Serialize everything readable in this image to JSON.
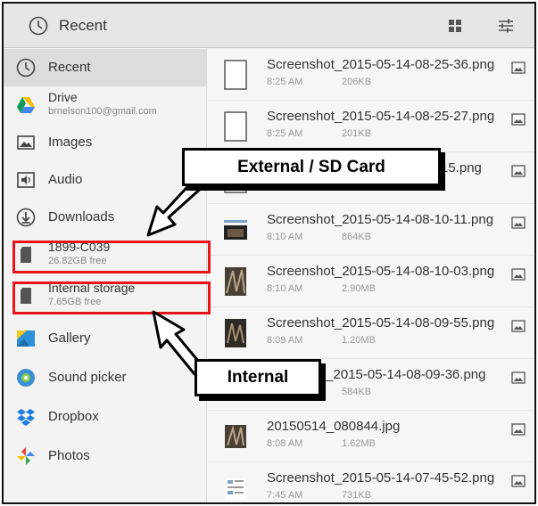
{
  "header": {
    "title": "Recent"
  },
  "sidebar": {
    "items": [
      {
        "label": "Recent",
        "icon": "clock-icon"
      },
      {
        "label": "Drive",
        "sublabel": "brnelson100@gmail.com",
        "icon": "drive-icon"
      },
      {
        "label": "Images",
        "icon": "image-icon"
      },
      {
        "label": "Audio",
        "icon": "audio-icon"
      },
      {
        "label": "Downloads",
        "icon": "download-icon"
      },
      {
        "label": "1899-C039",
        "sublabel": "26.82GB free",
        "icon": "sd-card-icon"
      },
      {
        "label": "Internal storage",
        "sublabel": "7.65GB free",
        "icon": "sd-card-icon"
      },
      {
        "label": "Gallery",
        "icon": "gallery-icon"
      },
      {
        "label": "Sound picker",
        "icon": "sound-picker-icon"
      },
      {
        "label": "Dropbox",
        "icon": "dropbox-icon"
      },
      {
        "label": "Photos",
        "icon": "photos-icon"
      }
    ]
  },
  "files": [
    {
      "name": "Screenshot_2015-05-14-08-25-36.png",
      "time": "8:25 AM",
      "size": "206KB",
      "thumb": "blank"
    },
    {
      "name": "Screenshot_2015-05-14-08-25-27.png",
      "time": "8:25 AM",
      "size": "201KB",
      "thumb": "blank"
    },
    {
      "name": "-15.png",
      "time": "",
      "size": "",
      "thumb": "blank"
    },
    {
      "name": "Screenshot_2015-05-14-08-10-11.png",
      "time": "8:10 AM",
      "size": "864KB",
      "thumb": "wide"
    },
    {
      "name": "Screenshot_2015-05-14-08-10-03.png",
      "time": "8:10 AM",
      "size": "2.90MB",
      "thumb": "photo"
    },
    {
      "name": "Screenshot_2015-05-14-08-09-55.png",
      "time": "8:09 AM",
      "size": "1.20MB",
      "thumb": "photo"
    },
    {
      "name": "t_2015-05-14-08-09-36.png",
      "time": "",
      "size": "584KB",
      "thumb": "photo"
    },
    {
      "name": "20150514_080844.jpg",
      "time": "8:08 AM",
      "size": "1.62MB",
      "thumb": "photo"
    },
    {
      "name": "Screenshot_2015-05-14-07-45-52.png",
      "time": "7:45 AM",
      "size": "731KB",
      "thumb": "doc"
    }
  ],
  "annotations": {
    "external_label": "External / SD Card",
    "internal_label": "Internal"
  },
  "colors": {
    "highlight": "#e8141b",
    "selected": "#dcdcdc"
  }
}
